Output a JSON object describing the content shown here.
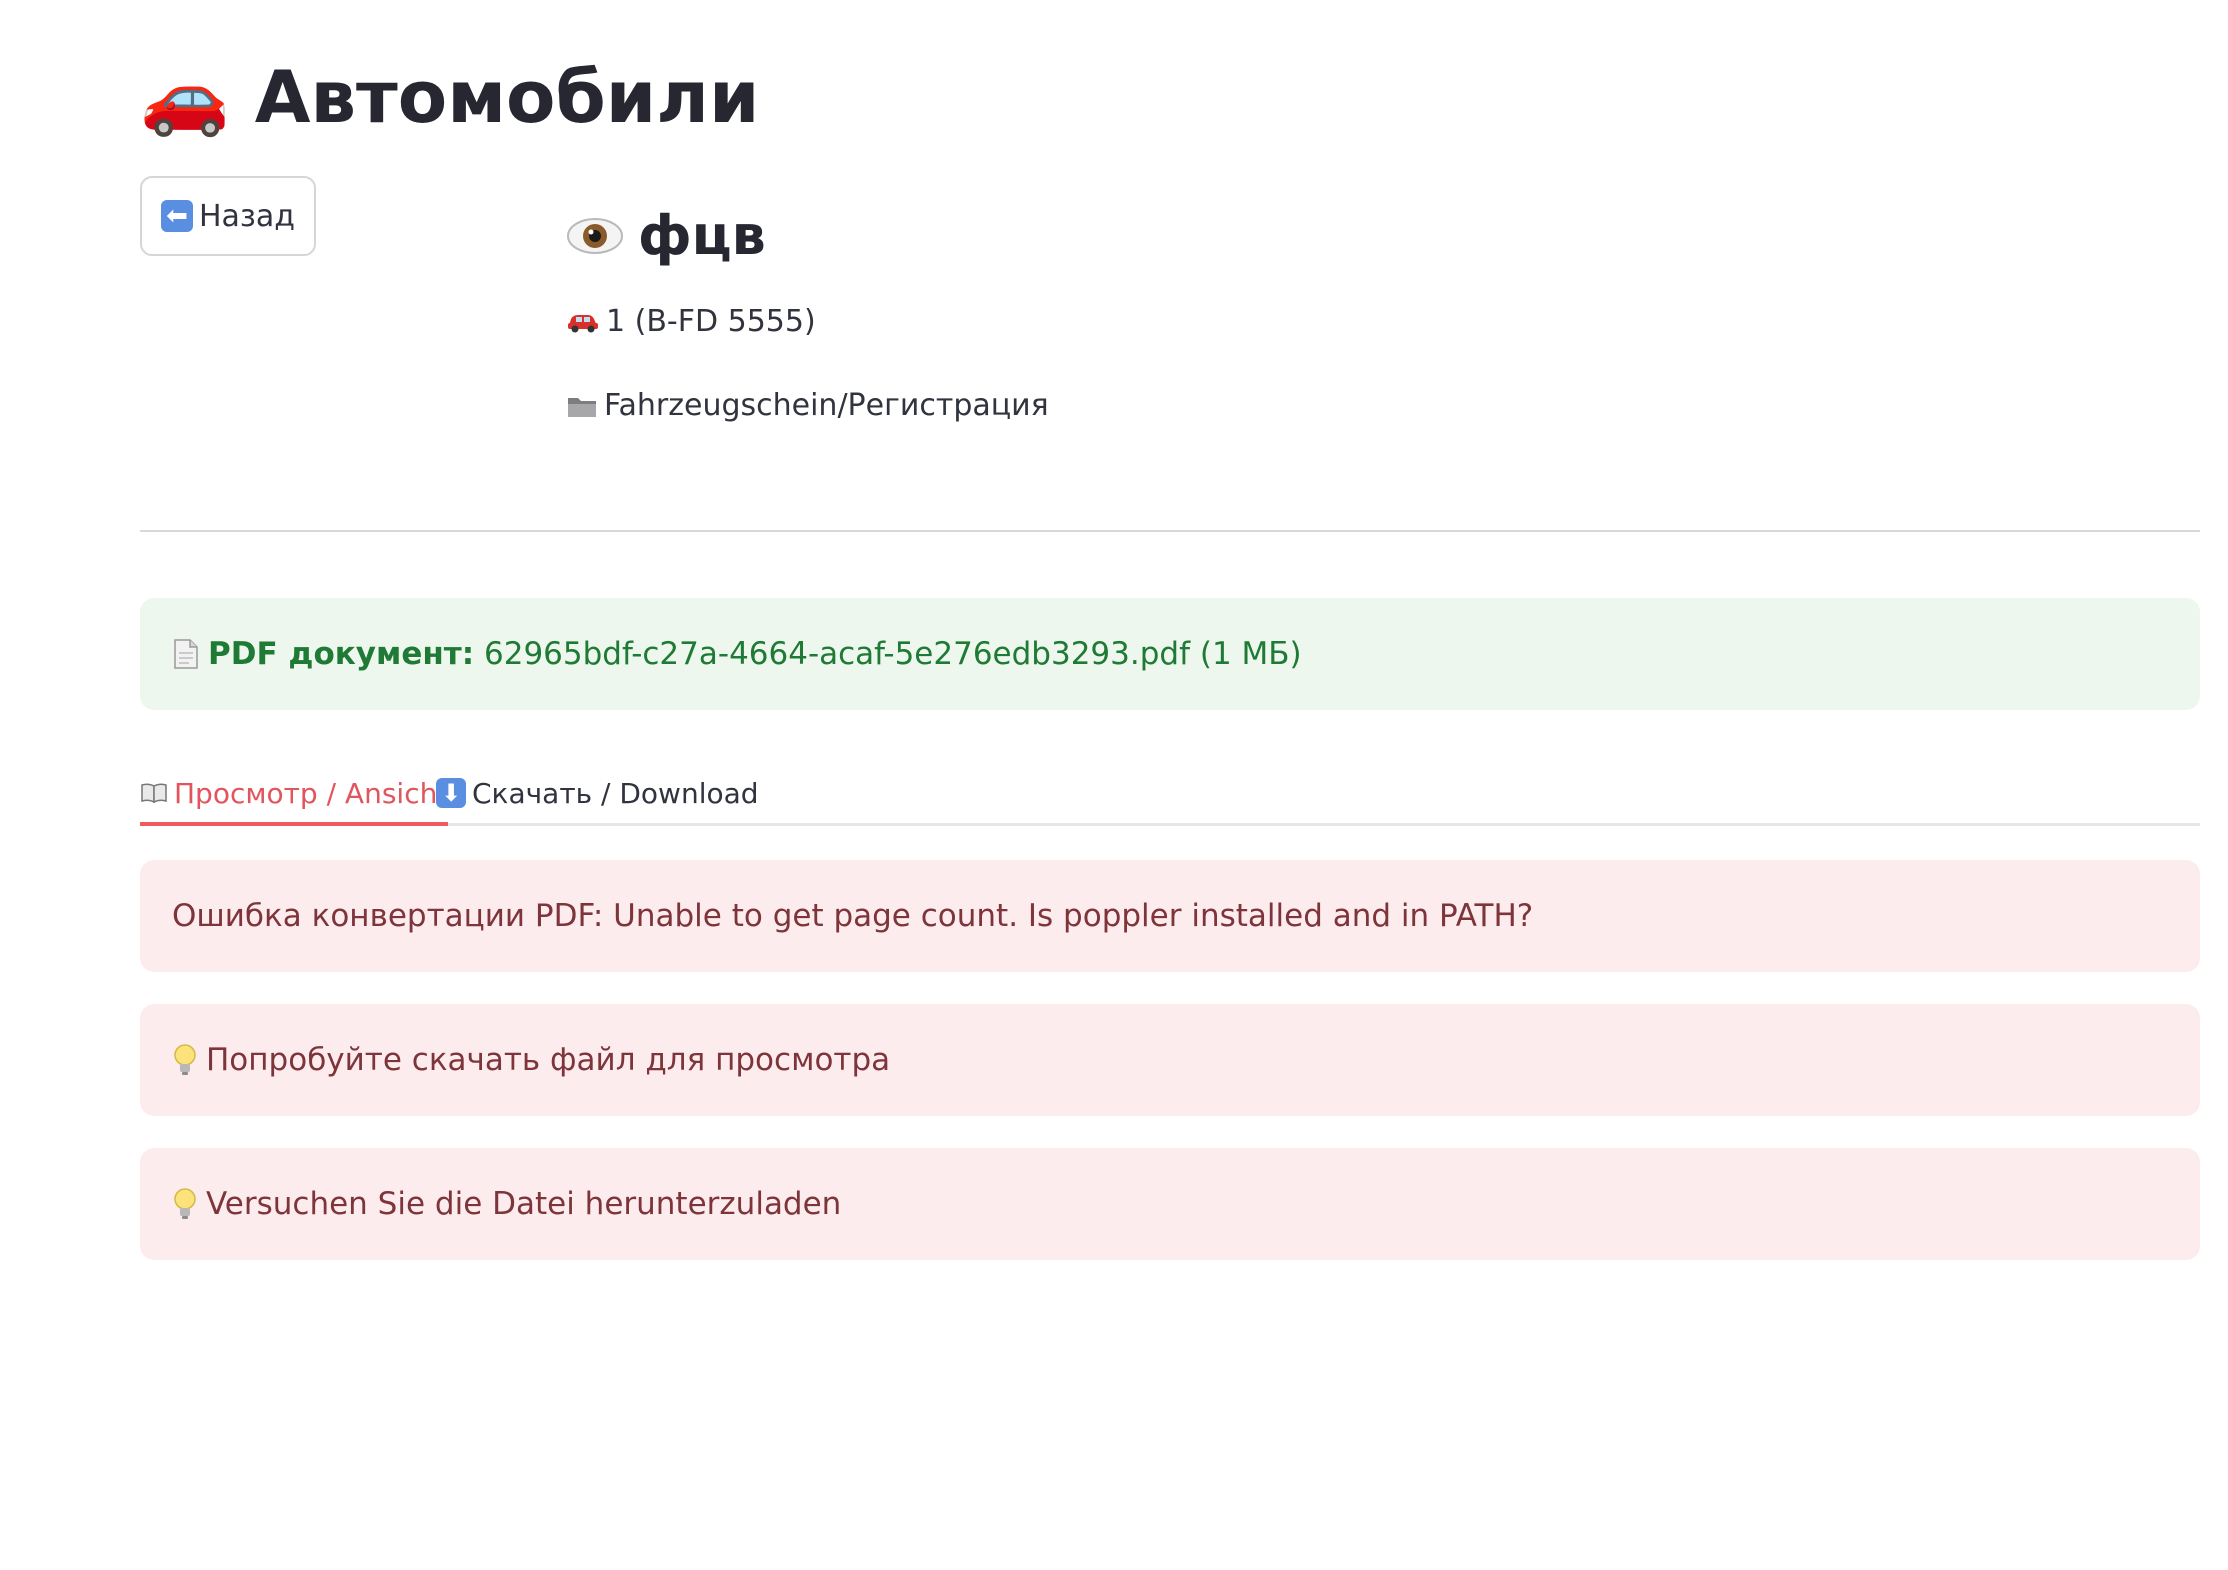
{
  "header": {
    "title": "🚗 Автомобили",
    "back_button_label": "Назад",
    "back_icon": "left-arrow-icon"
  },
  "document": {
    "title": "фцв",
    "title_icon": "eye-icon",
    "vehicle_label": "1 (B-FD 5555)",
    "vehicle_icon": "car-icon",
    "category_label": "Fahrzeugschein/Регистрация",
    "category_icon": "folder-icon"
  },
  "pdf_info": {
    "label": "PDF документ:",
    "filename": "62965bdf-c27a-4664-acaf-5e276edb3293.pdf (1 МБ)",
    "icon": "page-icon"
  },
  "tabs": [
    {
      "label": "Просмотр / Ansicht",
      "icon": "book-icon",
      "active": true
    },
    {
      "label": "Скачать / Download",
      "icon": "down-arrow-icon",
      "active": false
    }
  ],
  "alerts": [
    {
      "text": "Ошибка конвертации PDF: Unable to get page count. Is poppler installed and in PATH?",
      "type": "error"
    },
    {
      "text": "Попробуйте скачать файл для просмотра",
      "type": "error",
      "icon": "bulb-icon"
    },
    {
      "text": "Versuchen Sie die Datei herunterzuladen",
      "type": "error",
      "icon": "bulb-icon"
    }
  ],
  "colors": {
    "accent": "#ef5b5e",
    "success_bg": "#edf7ee",
    "success_text": "#1e7a34",
    "error_bg": "#fdeced",
    "error_text": "#7d353b"
  }
}
